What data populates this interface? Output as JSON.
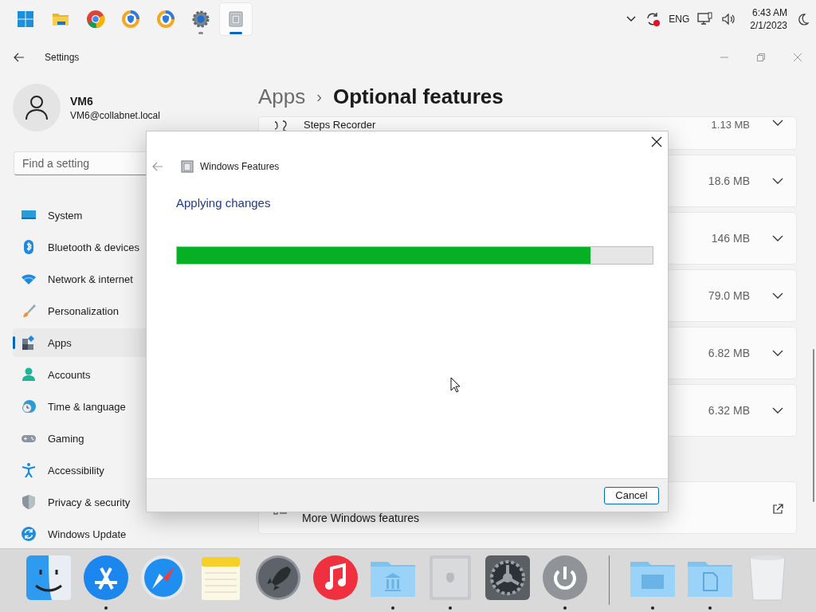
{
  "taskbar": {
    "apps": [
      {
        "kind": "start",
        "running": false,
        "active": false
      },
      {
        "kind": "folder",
        "running": false,
        "active": false
      },
      {
        "kind": "chrome",
        "running": false,
        "active": false
      },
      {
        "kind": "shield",
        "running": false,
        "active": false
      },
      {
        "kind": "shield",
        "running": false,
        "active": false
      },
      {
        "kind": "settings",
        "running": true,
        "active": false
      },
      {
        "kind": "package",
        "running": true,
        "active": true
      }
    ],
    "tray": {
      "language": "ENG",
      "time": "6:43 AM",
      "date": "2/1/2023"
    }
  },
  "settings": {
    "title": "Settings",
    "user": {
      "name": "VM6",
      "email": "VM6@collabnet.local"
    },
    "search": {
      "placeholder": "Find a setting"
    },
    "nav": [
      {
        "kind": "system",
        "label": "System",
        "selected": false
      },
      {
        "kind": "bluetooth",
        "label": "Bluetooth & devices",
        "selected": false
      },
      {
        "kind": "network",
        "label": "Network & internet",
        "selected": false
      },
      {
        "kind": "personalization",
        "label": "Personalization",
        "selected": false
      },
      {
        "kind": "apps",
        "label": "Apps",
        "selected": true
      },
      {
        "kind": "accounts",
        "label": "Accounts",
        "selected": false
      },
      {
        "kind": "time",
        "label": "Time & language",
        "selected": false
      },
      {
        "kind": "gaming",
        "label": "Gaming",
        "selected": false
      },
      {
        "kind": "accessibility",
        "label": "Accessibility",
        "selected": false
      },
      {
        "kind": "privacy",
        "label": "Privacy & security",
        "selected": false
      },
      {
        "kind": "update",
        "label": "Windows Update",
        "selected": false
      }
    ],
    "breadcrumb": {
      "parent": "Apps",
      "separator": "›",
      "current": "Optional features"
    },
    "features": [
      {
        "name": "Steps Recorder",
        "size": "1.13 MB"
      },
      {
        "size": "18.6 MB"
      },
      {
        "size": "146 MB"
      },
      {
        "size": "79.0 MB"
      },
      {
        "size": "6.82 MB"
      },
      {
        "size": "6.32 MB"
      }
    ],
    "more_link": {
      "label": "More Windows features"
    }
  },
  "dialog": {
    "title": "Windows Features",
    "heading": "Applying changes",
    "progress": {
      "level": 0.87
    },
    "buttons": [
      "Cancel"
    ]
  },
  "dock": {
    "apps": [
      {
        "kind": "finder",
        "running": false
      },
      {
        "kind": "appstore",
        "running": true
      },
      {
        "kind": "safari",
        "running": false
      },
      {
        "kind": "notes",
        "running": false
      },
      {
        "kind": "launchpad",
        "running": false
      },
      {
        "kind": "music",
        "running": false
      },
      {
        "kind": "folder-bank",
        "running": true
      },
      {
        "kind": "computer",
        "running": true
      },
      {
        "kind": "gears",
        "running": false
      },
      {
        "kind": "power",
        "running": true
      }
    ],
    "folders": [
      {
        "kind": "folder-window",
        "running": true
      },
      {
        "kind": "folder-doc",
        "running": true
      },
      {
        "kind": "trash",
        "running": false
      }
    ]
  }
}
